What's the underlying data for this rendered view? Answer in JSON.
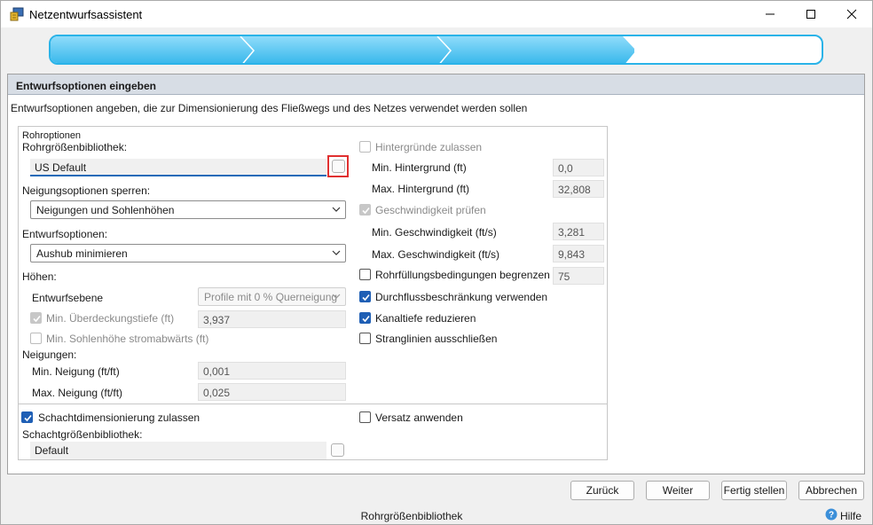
{
  "window": {
    "title": "Netzentwurfsassistent",
    "minimize_icon": "minimize-icon",
    "maximize_icon": "maximize-icon",
    "close_icon": "close-icon"
  },
  "wizard": {
    "steps_total": 4,
    "steps_completed": 3,
    "accent": "#2ab3e8"
  },
  "panel": {
    "header": "Entwurfsoptionen eingeben",
    "description": "Entwurfsoptionen angeben, die zur Dimensionierung des Fließwegs und des Netzes verwendet werden sollen"
  },
  "left": {
    "group_title": "Rohroptionen",
    "pipe_library_label": "Rohrgrößenbibliothek:",
    "pipe_library_value": "US Default",
    "slope_lock_label": "Neigungsoptionen sperren:",
    "slope_lock_value": "Neigungen und Sohlenhöhen",
    "design_options_label": "Entwurfsoptionen:",
    "design_options_value": "Aushub minimieren",
    "heights_label": "Höhen:",
    "design_plane_label": "Entwurfsebene",
    "design_plane_value": "Profile mit 0 % Querneigung",
    "min_cover_label": "Min. Überdeckungstiefe (ft)",
    "min_cover_value": "3,937",
    "min_invert_label": "Min. Sohlenhöhe stromabwärts (ft)",
    "slopes_label": "Neigungen:",
    "min_slope_label": "Min. Neigung (ft/ft)",
    "min_slope_value": "0,001",
    "max_slope_label": "Max. Neigung (ft/ft)",
    "max_slope_value": "0,025",
    "structure_sizing_label": "Schachtdimensionierung zulassen",
    "structure_library_label": "Schachtgrößenbibliothek:",
    "structure_library_value": "Default"
  },
  "right": {
    "allow_backgrounds_label": "Hintergründe zulassen",
    "min_background_label": "Min. Hintergrund (ft)",
    "min_background_value": "0,0",
    "max_background_label": "Max. Hintergrund (ft)",
    "max_background_value": "32,808",
    "check_velocity_label": "Geschwindigkeit prüfen",
    "min_velocity_label": "Min. Geschwindigkeit (ft/s)",
    "min_velocity_value": "3,281",
    "max_velocity_label": "Max. Geschwindigkeit (ft/s)",
    "max_velocity_value": "9,843",
    "limit_fill_label": "Rohrfüllungsbedingungen begrenzen (%)",
    "limit_fill_value": "75",
    "flow_constraint_label": "Durchflussbeschränkung verwenden",
    "reduce_depth_label": "Kanaltiefe reduzieren",
    "exclude_branches_label": "Stranglinien ausschließen",
    "apply_offset_label": "Versatz anwenden"
  },
  "checks": {
    "allow_backgrounds": false,
    "check_velocity": true,
    "limit_fill": false,
    "flow_constraint": true,
    "reduce_depth": true,
    "exclude_branches": false,
    "min_cover": true,
    "min_invert": false,
    "structure_sizing": true,
    "apply_offset": false
  },
  "buttons": {
    "back": "Zurück",
    "next": "Weiter",
    "finish": "Fertig stellen",
    "cancel": "Abbrechen"
  },
  "status": {
    "text": "Rohrgrößenbibliothek",
    "help": "Hilfe"
  }
}
